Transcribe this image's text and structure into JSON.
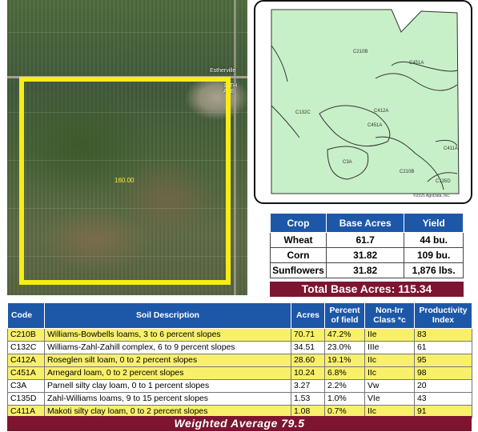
{
  "aerial": {
    "road_label_top": "Estherville",
    "road_label_right": "18TH AVE",
    "field_acres": "160.00"
  },
  "soil_map": {
    "labels": [
      "C210B",
      "C451A",
      "C132C",
      "C412A",
      "C451A",
      "C3A",
      "C210B",
      "C411A",
      "C135D"
    ],
    "copyright": "©2025 AgriData, Inc.",
    "colors": {
      "soil_fill": "#c8f0c8",
      "soil_line": "#333333"
    }
  },
  "crop_table": {
    "headers": [
      "Crop",
      "Base Acres",
      "Yield"
    ],
    "rows": [
      [
        "Wheat",
        "61.7",
        "44 bu."
      ],
      [
        "Corn",
        "31.82",
        "109 bu."
      ],
      [
        "Sunflowers",
        "31.82",
        "1,876 lbs."
      ]
    ],
    "total": "Total Base Acres: 115.34"
  },
  "soil_table": {
    "headers": [
      "Code",
      "Soil Description",
      "Acres",
      "Percent of field",
      "Non-Irr Class *c",
      "Productivity Index"
    ],
    "rows": [
      {
        "code": "C210B",
        "desc": "Williams-Bowbells loams, 3 to 6 percent slopes",
        "acres": "70.71",
        "pct": "47.2%",
        "cls": "IIe",
        "pi": "83",
        "highlight": true
      },
      {
        "code": "C132C",
        "desc": "Williams-Zahl-Zahill complex, 6 to 9 percent slopes",
        "acres": "34.51",
        "pct": "23.0%",
        "cls": "IIIe",
        "pi": "61",
        "highlight": false
      },
      {
        "code": "C412A",
        "desc": "Roseglen silt loam, 0 to 2 percent slopes",
        "acres": "28.60",
        "pct": "19.1%",
        "cls": "IIc",
        "pi": "95",
        "highlight": true
      },
      {
        "code": "C451A",
        "desc": "Arnegard loam, 0 to 2 percent slopes",
        "acres": "10.24",
        "pct": "6.8%",
        "cls": "IIc",
        "pi": "98",
        "highlight": true
      },
      {
        "code": "C3A",
        "desc": "Parnell silty clay loam, 0 to 1 percent slopes",
        "acres": "3.27",
        "pct": "2.2%",
        "cls": "Vw",
        "pi": "20",
        "highlight": false
      },
      {
        "code": "C135D",
        "desc": "Zahl-Williams loams, 9 to 15 percent slopes",
        "acres": "1.53",
        "pct": "1.0%",
        "cls": "VIe",
        "pi": "43",
        "highlight": false
      },
      {
        "code": "C411A",
        "desc": "Makoti silty clay loam, 0 to 2 percent slopes",
        "acres": "1.08",
        "pct": "0.7%",
        "cls": "IIc",
        "pi": "91",
        "highlight": true
      }
    ],
    "weighted_average": "Weighted Average  79.5"
  }
}
